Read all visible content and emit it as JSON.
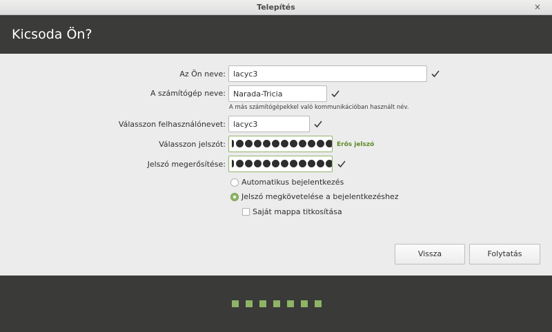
{
  "window": {
    "title": "Telepítés",
    "close_glyph": "×"
  },
  "header": {
    "title": "Kicsoda Ön?"
  },
  "form": {
    "name_label": "Az Ön neve:",
    "name_value": "lacyc3",
    "computer_label": "A számítógép neve:",
    "computer_value": "Narada-Tricia",
    "computer_hint": "A más számítógépekkel való kommunikációban használt név.",
    "username_label": "Válasszon felhasználónevet:",
    "username_value": "lacyc3",
    "password_label": "Válasszon jelszót:",
    "password_strength": "Erős jelszó",
    "confirm_label": "Jelszó megerősítése:",
    "option_auto_login": "Automatikus bejelentkezés",
    "option_require_password": "Jelszó megkövetelése a bejelentkezéshez",
    "selected_option": "require_password",
    "encrypt_home_label": "Saját mappa titkosítása",
    "encrypt_home_checked": false
  },
  "buttons": {
    "back": "Vissza",
    "continue": "Folytatás"
  },
  "progress": {
    "steps": 7
  },
  "colors": {
    "accent": "#8fb466",
    "strength_text": "#5c8a27",
    "dark_bg": "#3a3a38",
    "panel_bg": "#ececec"
  },
  "icons": {
    "valid": "checkmark-icon"
  }
}
